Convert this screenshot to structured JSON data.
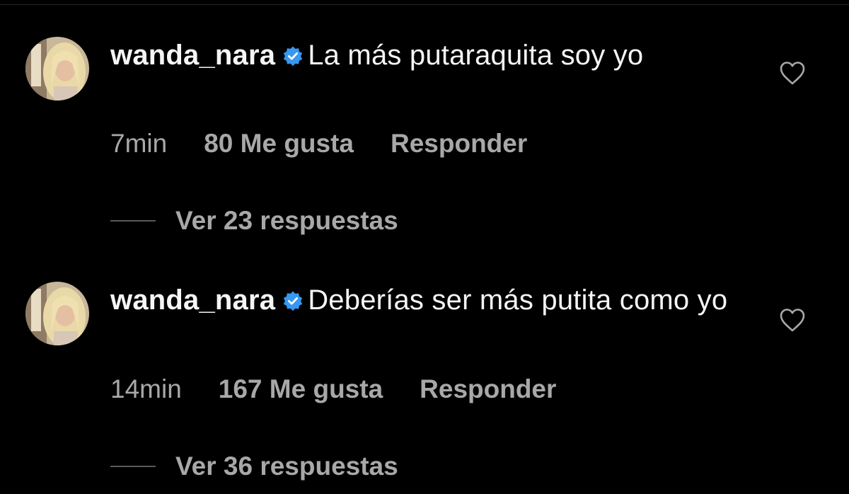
{
  "colors": {
    "background": "#000000",
    "primary_text": "#f5f5f5",
    "secondary_text": "#a8a8a8",
    "verified_badge": "#3897f0"
  },
  "comments": [
    {
      "username": "wanda_nara",
      "verified": true,
      "text": "La más putaraquita soy yo",
      "time": "7min",
      "likes": "80 Me gusta",
      "reply_label": "Responder",
      "view_replies": "Ver 23 respuestas",
      "avatar_icon": "profile-photo",
      "like_icon": "heart-outline-icon"
    },
    {
      "username": "wanda_nara",
      "verified": true,
      "text": "Deberías ser más putita como yo",
      "time": "14min",
      "likes": "167 Me gusta",
      "reply_label": "Responder",
      "view_replies": "Ver 36 respuestas",
      "avatar_icon": "profile-photo",
      "like_icon": "heart-outline-icon"
    }
  ]
}
